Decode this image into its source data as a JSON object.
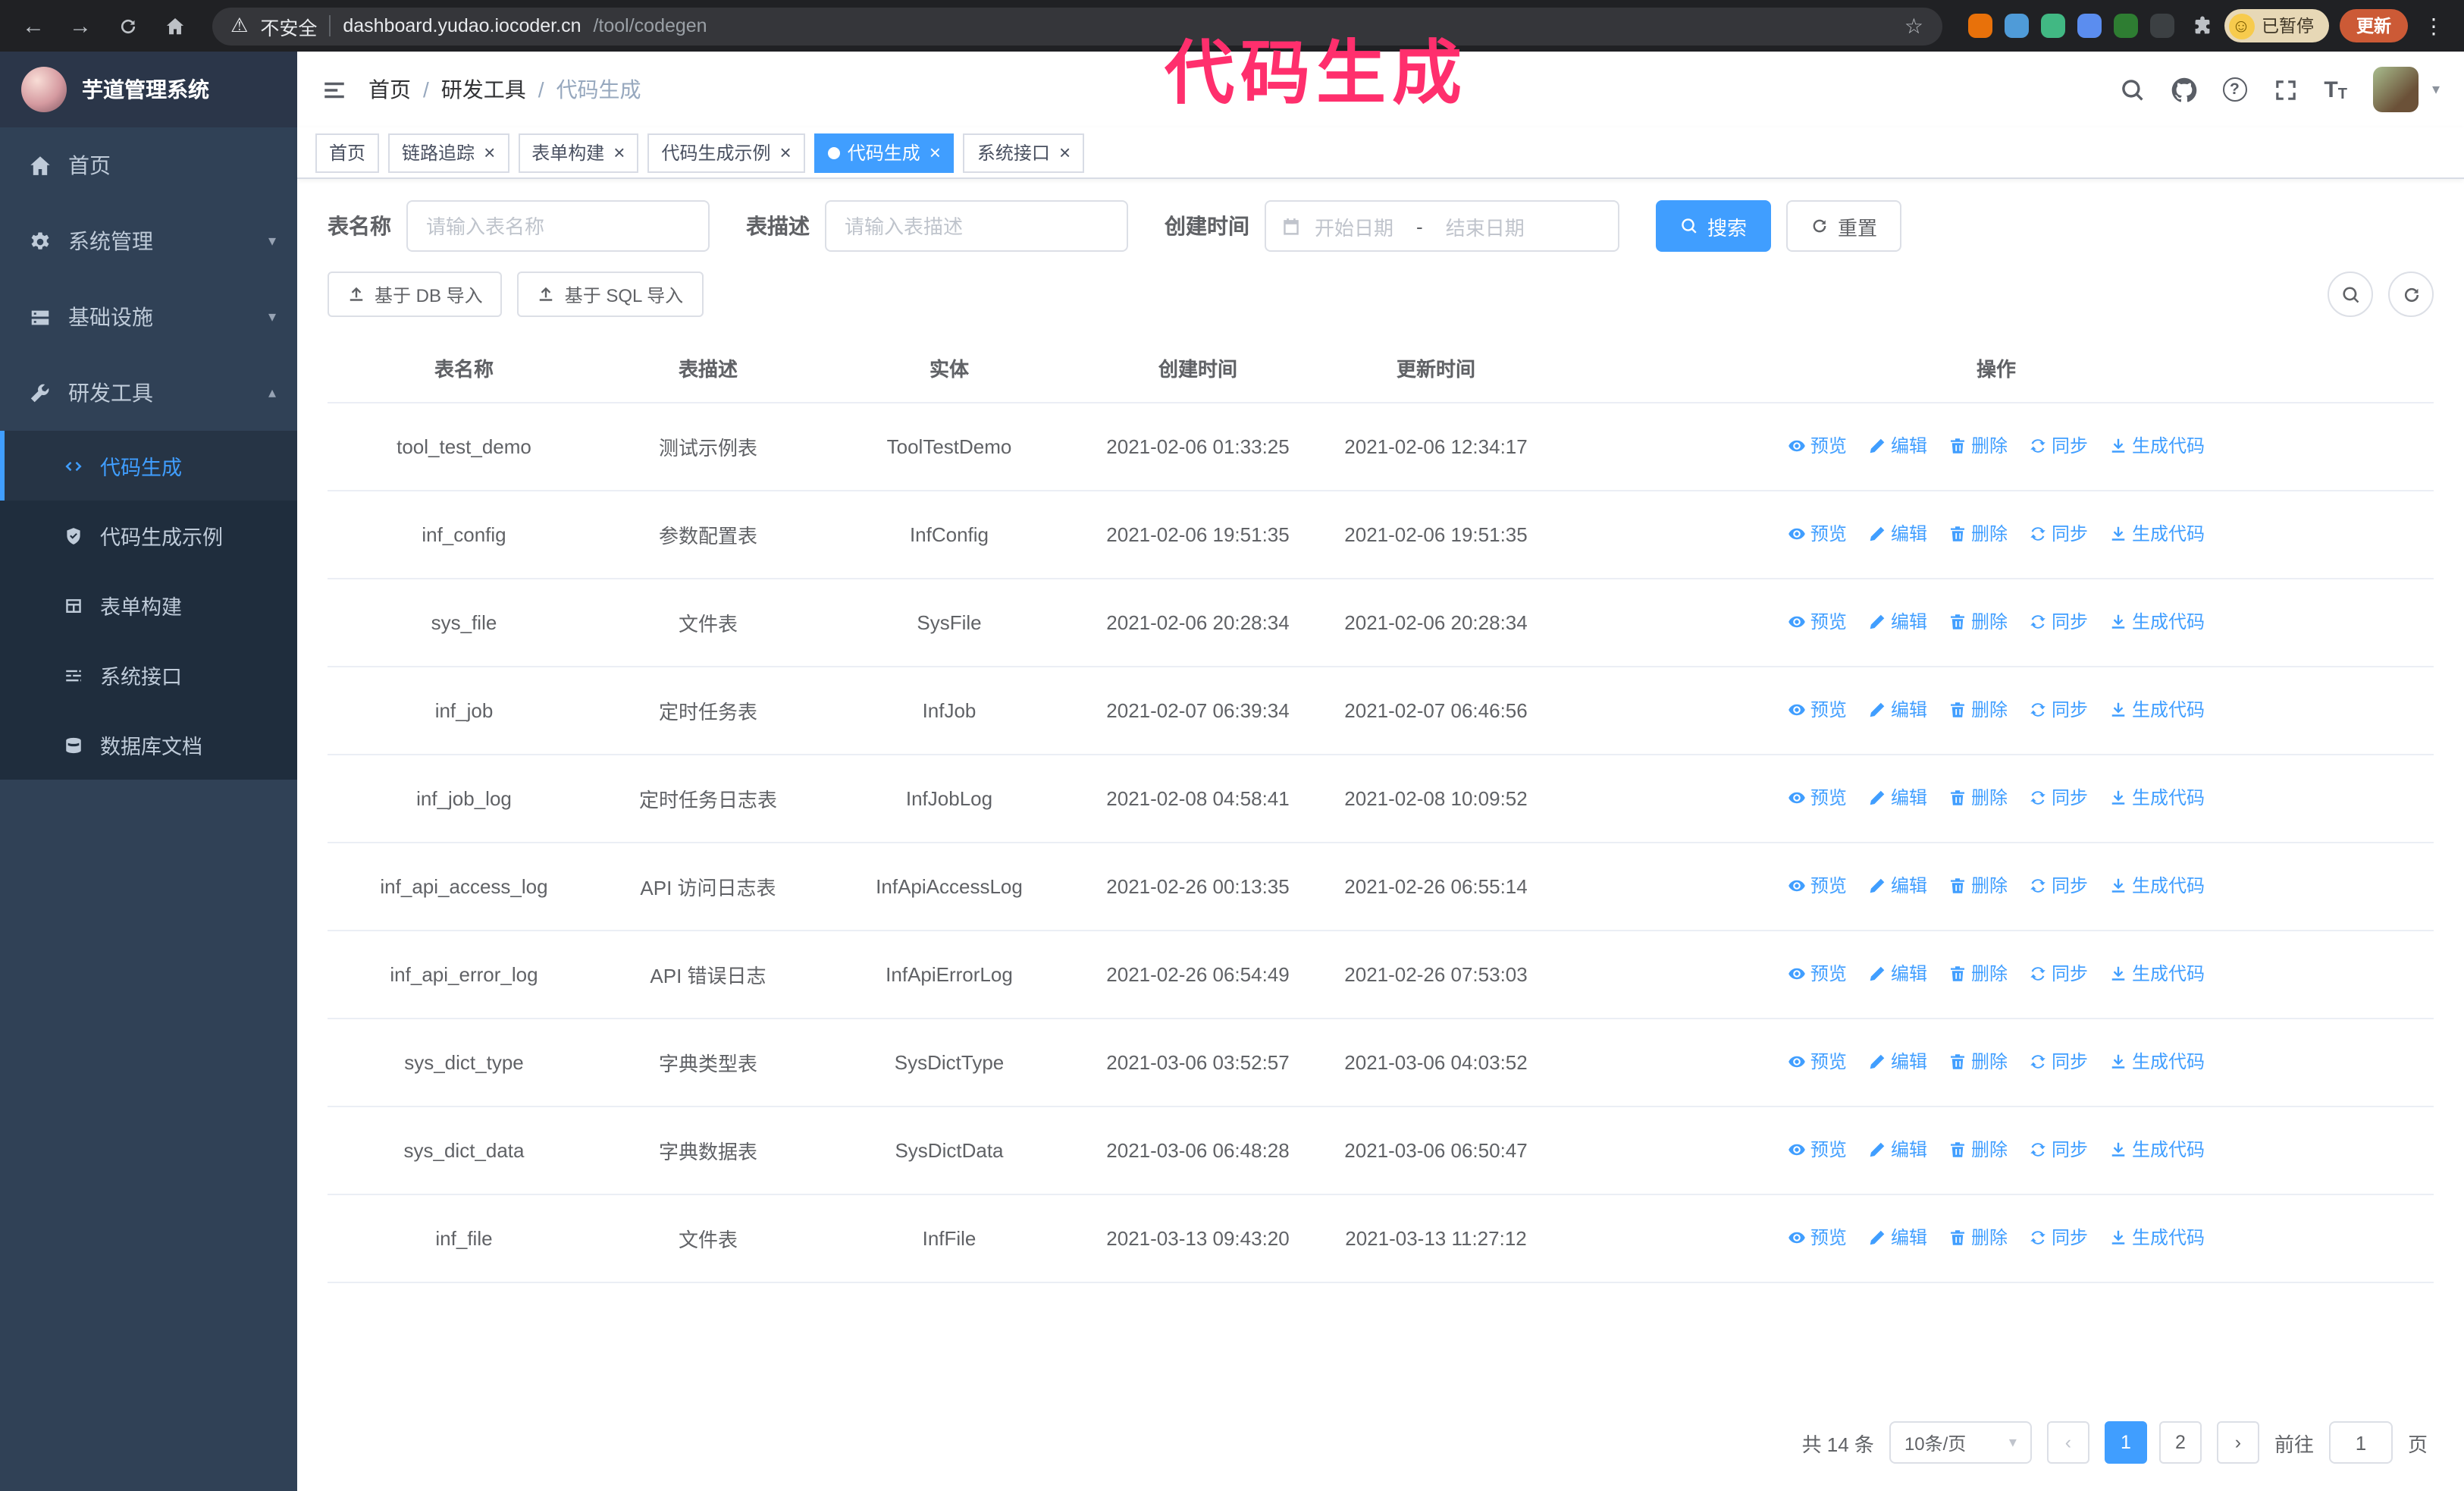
{
  "annotation": {
    "text": "代码生成",
    "color": "#ff2f6d"
  },
  "colors": {
    "accent": "#409eff",
    "sidebar_bg": "#304156",
    "annotation": "#ff2f6d",
    "update_button": "#cc5a36"
  },
  "icons": {
    "back": "←",
    "forward": "→",
    "warning": "⚠",
    "star": "☆",
    "menu_dots": "⋮",
    "smiley": "☺",
    "question": "?",
    "caret_down": "▾",
    "caret_up": "▴",
    "close": "×",
    "prev": "‹",
    "next": "›",
    "font": "T"
  },
  "browser": {
    "security_label": "不安全",
    "url_host": "dashboard.yudao.iocoder.cn",
    "url_path": "/tool/codegen",
    "paused_label": "已暂停",
    "update_label": "更新",
    "extensions": [
      {
        "name": "extension-icon-orange",
        "color": "#e8710a"
      },
      {
        "name": "extension-icon-blue-drop",
        "color": "#4f9bd8"
      },
      {
        "name": "extension-icon-vue",
        "color": "#41b883"
      },
      {
        "name": "extension-icon-people",
        "color": "#5b8def"
      },
      {
        "name": "extension-icon-green",
        "color": "#2e7d32"
      },
      {
        "name": "extension-icon-dark",
        "color": "#3c4043"
      }
    ]
  },
  "sidebar": {
    "app_title": "芋道管理系统",
    "menu": [
      {
        "label": "首页",
        "icon": "home"
      },
      {
        "label": "系统管理",
        "icon": "gear",
        "chevron": "down"
      },
      {
        "label": "基础设施",
        "icon": "server",
        "chevron": "down"
      },
      {
        "label": "研发工具",
        "icon": "tools",
        "chevron": "up",
        "children": [
          {
            "label": "代码生成",
            "icon": "code",
            "active": true
          },
          {
            "label": "代码生成示例",
            "icon": "shield"
          },
          {
            "label": "表单构建",
            "icon": "table"
          },
          {
            "label": "系统接口",
            "icon": "api"
          },
          {
            "label": "数据库文档",
            "icon": "db"
          }
        ]
      }
    ]
  },
  "navbar": {
    "breadcrumb": [
      "首页",
      "研发工具",
      "代码生成"
    ]
  },
  "tabs": [
    {
      "label": "首页",
      "closable": false,
      "active": false
    },
    {
      "label": "链路追踪",
      "closable": true,
      "active": false
    },
    {
      "label": "表单构建",
      "closable": true,
      "active": false
    },
    {
      "label": "代码生成示例",
      "closable": true,
      "active": false
    },
    {
      "label": "代码生成",
      "closable": true,
      "active": true
    },
    {
      "label": "系统接口",
      "closable": true,
      "active": false
    }
  ],
  "filters": {
    "table_name_label": "表名称",
    "table_name_placeholder": "请输入表名称",
    "table_desc_label": "表描述",
    "table_desc_placeholder": "请输入表描述",
    "create_time_label": "创建时间",
    "date_start_placeholder": "开始日期",
    "date_separator": "-",
    "date_end_placeholder": "结束日期",
    "search_label": "搜索",
    "reset_label": "重置"
  },
  "toolbar": {
    "import_db_label": "基于 DB 导入",
    "import_sql_label": "基于 SQL 导入"
  },
  "table": {
    "columns": [
      "表名称",
      "表描述",
      "实体",
      "创建时间",
      "更新时间",
      "操作"
    ],
    "actions": [
      "预览",
      "编辑",
      "删除",
      "同步",
      "生成代码"
    ],
    "action_icons": [
      "eye",
      "edit",
      "trash",
      "sync",
      "gen"
    ],
    "rows": [
      {
        "name": "tool_test_demo",
        "desc": "测试示例表",
        "entity": "ToolTestDemo",
        "created": "2021-02-06 01:33:25",
        "updated": "2021-02-06 12:34:17"
      },
      {
        "name": "inf_config",
        "desc": "参数配置表",
        "entity": "InfConfig",
        "created": "2021-02-06 19:51:35",
        "updated": "2021-02-06 19:51:35"
      },
      {
        "name": "sys_file",
        "desc": "文件表",
        "entity": "SysFile",
        "created": "2021-02-06 20:28:34",
        "updated": "2021-02-06 20:28:34"
      },
      {
        "name": "inf_job",
        "desc": "定时任务表",
        "entity": "InfJob",
        "created": "2021-02-07 06:39:34",
        "updated": "2021-02-07 06:46:56"
      },
      {
        "name": "inf_job_log",
        "desc": "定时任务日志表",
        "entity": "InfJobLog",
        "created": "2021-02-08 04:58:41",
        "updated": "2021-02-08 10:09:52"
      },
      {
        "name": "inf_api_access_log",
        "desc": "API 访问日志表",
        "entity": "InfApiAccessLog",
        "created": "2021-02-26 00:13:35",
        "updated": "2021-02-26 06:55:14"
      },
      {
        "name": "inf_api_error_log",
        "desc": "API 错误日志",
        "entity": "InfApiErrorLog",
        "created": "2021-02-26 06:54:49",
        "updated": "2021-02-26 07:53:03"
      },
      {
        "name": "sys_dict_type",
        "desc": "字典类型表",
        "entity": "SysDictType",
        "created": "2021-03-06 03:52:57",
        "updated": "2021-03-06 04:03:52"
      },
      {
        "name": "sys_dict_data",
        "desc": "字典数据表",
        "entity": "SysDictData",
        "created": "2021-03-06 06:48:28",
        "updated": "2021-03-06 06:50:47"
      },
      {
        "name": "inf_file",
        "desc": "文件表",
        "entity": "InfFile",
        "created": "2021-03-13 09:43:20",
        "updated": "2021-03-13 11:27:12"
      }
    ]
  },
  "pagination": {
    "total": "共 14 条",
    "page_size": "10条/页",
    "pages": [
      "1",
      "2"
    ],
    "active_page": "1",
    "goto_label": "前往",
    "goto_value": "1",
    "page_label": "页"
  }
}
